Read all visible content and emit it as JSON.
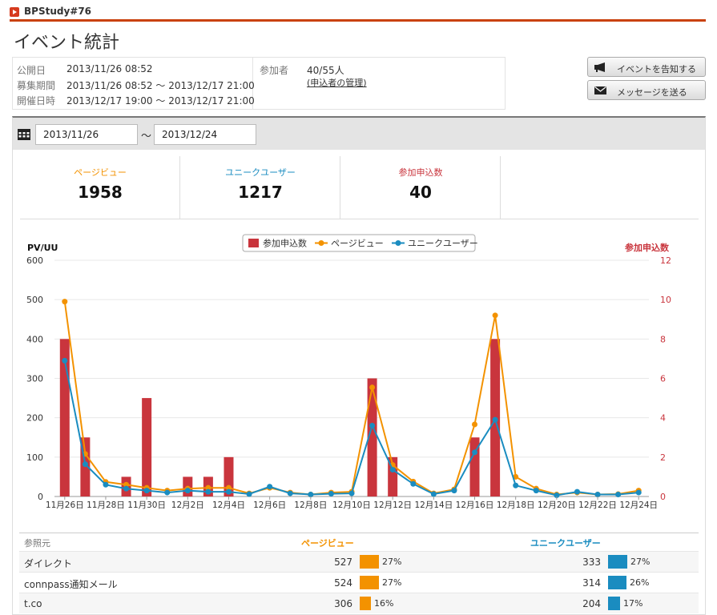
{
  "header": {
    "event_name": "BPStudy#76",
    "title": "イベント統計"
  },
  "info": {
    "published_label": "公開日",
    "published_value": "2013/11/26 08:52",
    "recruit_label": "募集期間",
    "recruit_value": "2013/11/26 08:52 〜 2013/12/17 21:00",
    "held_label": "開催日時",
    "held_value": "2013/12/17 19:00 〜 2013/12/17 21:00",
    "participants_label": "参加者",
    "participants_value": "40/55人",
    "manage_link": "(申込者の管理)"
  },
  "buttons": {
    "announce": "イベントを告知する",
    "message": "メッセージを送る"
  },
  "filter": {
    "from": "2013/11/26",
    "tilde": "〜",
    "to": "2013/12/24"
  },
  "stats": [
    {
      "label": "ページビュー",
      "value": "1958",
      "color": "#f39200"
    },
    {
      "label": "ユニークユーザー",
      "value": "1217",
      "color": "#1a8cc0"
    },
    {
      "label": "参加申込数",
      "value": "40",
      "color": "#c9353d"
    }
  ],
  "chart_data": {
    "type": "bar",
    "categories": [
      "11/26",
      "11/27",
      "11/28",
      "11/29",
      "11/30",
      "12/1",
      "12/2",
      "12/3",
      "12/4",
      "12/5",
      "12/6",
      "12/7",
      "12/8",
      "12/9",
      "12/10",
      "12/11",
      "12/12",
      "12/13",
      "12/14",
      "12/15",
      "12/16",
      "12/17",
      "12/18",
      "12/19",
      "12/20",
      "12/21",
      "12/22",
      "12/23",
      "12/24"
    ],
    "x_tick_labels": [
      "11月26日",
      "11月28日",
      "11月30日",
      "12月2日",
      "12月4日",
      "12月6日",
      "12月8日",
      "12月10日",
      "12月12日",
      "12月14日",
      "12月16日",
      "12月18日",
      "12月20日",
      "12月22日",
      "12月24日"
    ],
    "series": [
      {
        "name": "参加申込数",
        "type": "bar",
        "axis": "right",
        "color": "#c9353d",
        "values": [
          8,
          3,
          0,
          1,
          5,
          0,
          1,
          1,
          2,
          0,
          0,
          0,
          0,
          0,
          0,
          6,
          2,
          0,
          0,
          0,
          3,
          8,
          0,
          0,
          0,
          0,
          0,
          0,
          0
        ]
      },
      {
        "name": "ページビュー",
        "type": "line",
        "axis": "left",
        "color": "#f39200",
        "values": [
          495,
          108,
          37,
          30,
          22,
          15,
          20,
          22,
          22,
          8,
          22,
          10,
          5,
          10,
          12,
          277,
          80,
          38,
          8,
          18,
          183,
          460,
          50,
          20,
          5,
          10,
          5,
          6,
          15
        ]
      },
      {
        "name": "ユニークユーザー",
        "type": "line",
        "axis": "left",
        "color": "#1a8cc0",
        "values": [
          345,
          82,
          30,
          20,
          15,
          10,
          15,
          12,
          12,
          6,
          25,
          8,
          5,
          7,
          8,
          180,
          68,
          32,
          6,
          15,
          112,
          195,
          28,
          15,
          3,
          12,
          5,
          5,
          10
        ]
      }
    ],
    "ylabel": "PV/UU",
    "y2label": "参加申込数",
    "ylim": [
      0,
      600
    ],
    "y2lim": [
      0,
      12
    ],
    "yticks": [
      0,
      100,
      200,
      300,
      400,
      500,
      600
    ],
    "y2ticks": [
      0,
      2,
      4,
      6,
      8,
      10,
      12
    ],
    "legend": "top-center",
    "grid": true
  },
  "table": {
    "headers": [
      "参照元",
      "ページビュー",
      "ユニークユーザー"
    ],
    "rows": [
      {
        "source": "ダイレクト",
        "pv": "527",
        "pv_pct": "27%",
        "pv_frac": 0.27,
        "uu": "333",
        "uu_pct": "27%",
        "uu_frac": 0.27
      },
      {
        "source": "connpass通知メール",
        "pv": "524",
        "pv_pct": "27%",
        "pv_frac": 0.27,
        "uu": "314",
        "uu_pct": "26%",
        "uu_frac": 0.26
      },
      {
        "source": "t.co",
        "pv": "306",
        "pv_pct": "16%",
        "pv_frac": 0.16,
        "uu": "204",
        "uu_pct": "17%",
        "uu_frac": 0.17
      }
    ]
  }
}
